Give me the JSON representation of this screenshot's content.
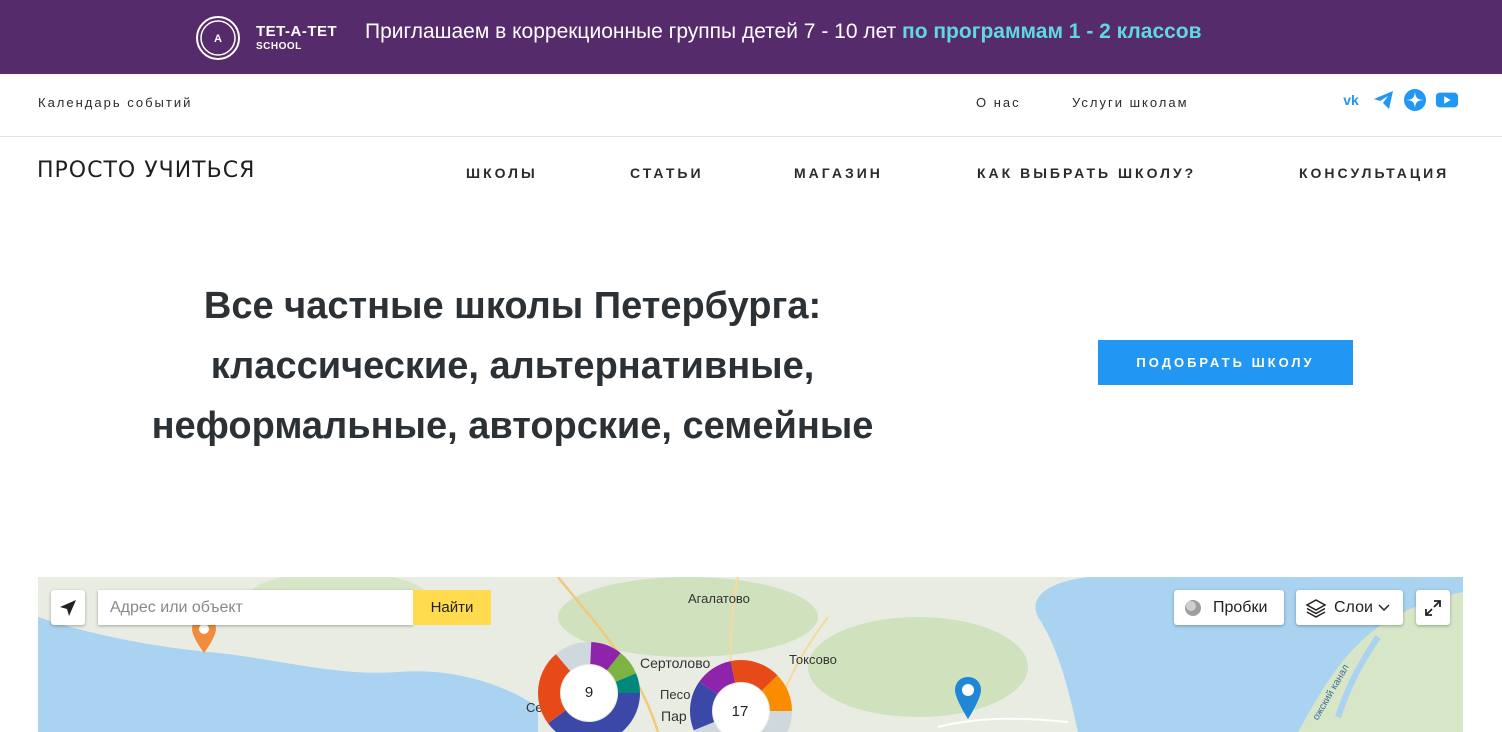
{
  "promo": {
    "logo_mark": "TET-A-TET",
    "brand": "TET-A-TET",
    "brand_sub": "SCHOOL",
    "text": "Приглашаем в коррекционные группы детей 7 - 10 лет ",
    "highlight": "по программам 1 - 2 классов",
    "colors": {
      "bg": "#562b6b",
      "highlight": "#5fd9e0"
    }
  },
  "topbar": {
    "calendar": "Календарь событий",
    "about": "О нас",
    "services": "Услуги школам",
    "social_icons": [
      "vk-icon",
      "telegram-icon",
      "zen-icon",
      "youtube-icon"
    ],
    "social_color": "#2196f3"
  },
  "header": {
    "logo": "ПРОСТО УЧИТЬСЯ",
    "nav": [
      "ШКОЛЫ",
      "СТАТЬИ",
      "МАГАЗИН",
      "КАК ВЫБРАТЬ ШКОЛУ?",
      "КОНСУЛЬТАЦИЯ"
    ]
  },
  "hero": {
    "line1": "Все частные школы Петербурга:",
    "line2": "классические, альтернативные,",
    "line3": "неформальные, авторские, семейные",
    "cta": "ПОДОБРАТЬ ШКОЛУ",
    "cta_color": "#2196f3"
  },
  "map": {
    "search_placeholder": "Адрес или объект",
    "search_button": "Найти",
    "traffic": "Пробки",
    "layers": "Слои",
    "places": [
      "Агалатово",
      "Сертолово",
      "Токсово",
      "Песо",
      "Пар",
      "Се"
    ],
    "clusters": [
      9,
      17
    ],
    "canal_label": "ожский канал"
  }
}
